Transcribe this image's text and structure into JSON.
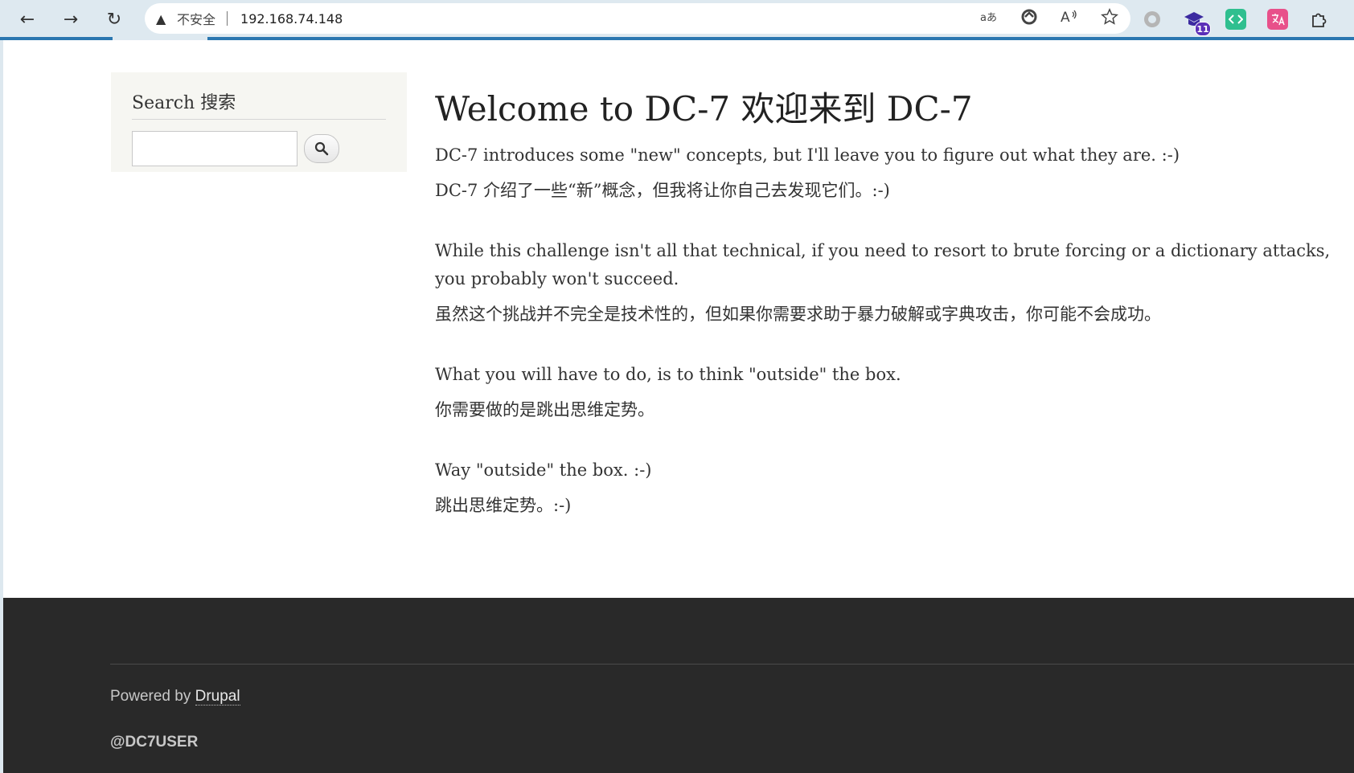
{
  "browser": {
    "back_glyph": "←",
    "forward_glyph": "→",
    "reload_glyph": "↻",
    "warning_glyph": "▲",
    "security_label": "不安全",
    "url": "192.168.74.148",
    "address_icons": [
      "translate-icon",
      "browser-essentials-icon",
      "read-aloud-icon",
      "favorite-star-icon"
    ],
    "extensions": [
      {
        "name": "circle-extension-icon",
        "color": "#a9a9a9"
      },
      {
        "name": "graduation-cap-extension-icon",
        "color": "#3b2aa0",
        "badge": "11"
      },
      {
        "name": "code-extension-icon",
        "color": "#2fbf8f"
      },
      {
        "name": "translate-extension-icon",
        "color": "#e8508a"
      },
      {
        "name": "puzzle-extensions-icon",
        "color": "#333333"
      }
    ]
  },
  "sidebar": {
    "search_title": "Search  搜索",
    "search_value": "",
    "search_button_icon": "magnifier-icon"
  },
  "main": {
    "title": "Welcome to DC-7  欢迎来到 DC-7",
    "paragraphs": [
      {
        "en": "DC-7 introduces some \"new\" concepts, but I'll leave you to figure out what they are.  :-)",
        "zh": "DC-7 介绍了一些“新”概念，但我将让你自己去发现它们。:-)"
      },
      {
        "en": "While this challenge isn't all that technical, if you need to resort to brute forcing or a dictionary attacks, you probably won't succeed.",
        "zh": "虽然这个挑战并不完全是技术性的，但如果你需要求助于暴力破解或字典攻击，你可能不会成功。"
      },
      {
        "en": "What you will have to do, is to think \"outside\" the box.",
        "zh": "你需要做的是跳出思维定势。"
      },
      {
        "en": "Way \"outside\" the box.  :-)",
        "zh": "跳出思维定势。:-)"
      }
    ]
  },
  "footer": {
    "powered_prefix": "Powered by ",
    "powered_link": "Drupal",
    "user": "@DC7USER"
  },
  "colors": {
    "accent": "#2b77b0",
    "footer_bg": "#292929",
    "sidebar_bg": "#f6f6f2"
  }
}
